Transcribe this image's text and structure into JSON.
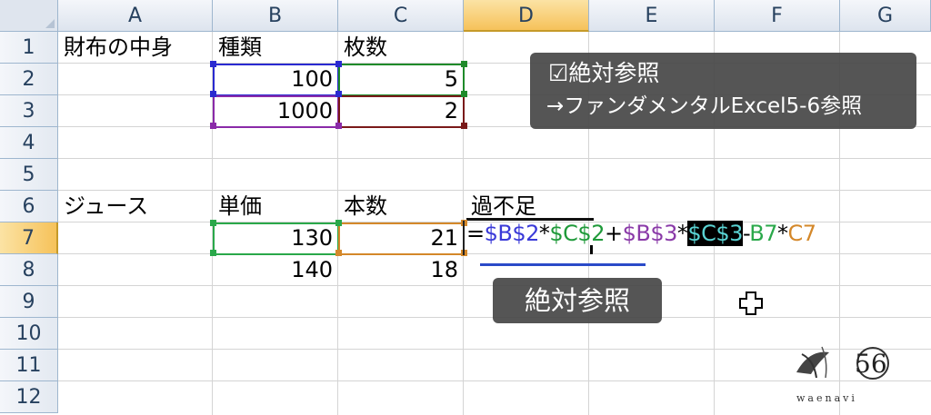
{
  "columns": [
    "A",
    "B",
    "C",
    "D",
    "E",
    "F",
    "G"
  ],
  "selected_column": "D",
  "rows": [
    "1",
    "2",
    "3",
    "4",
    "5",
    "6",
    "7",
    "8",
    "9",
    "10",
    "11",
    "12"
  ],
  "selected_row": "7",
  "cells": {
    "A1": "財布の中身",
    "B1": "種類",
    "C1": "枚数",
    "B2": "100",
    "C2": "5",
    "B3": "1000",
    "C3": "2",
    "A6": "ジュース",
    "B6": "単価",
    "C6": "本数",
    "D6": "過不足",
    "B7": "130",
    "C7": "21",
    "B8": "140",
    "C8": "18"
  },
  "formula_parts": [
    {
      "text": "=",
      "color": "#000000"
    },
    {
      "text": "$B$2",
      "color": "#3a3ad8"
    },
    {
      "text": "*",
      "color": "#000000"
    },
    {
      "text": "$C$2",
      "color": "#1f9a3a"
    },
    {
      "text": "+",
      "color": "#000000"
    },
    {
      "text": "$B$3",
      "color": "#8a3aa8"
    },
    {
      "text": "*",
      "color": "#000000"
    },
    {
      "text": "$C$3",
      "color": "#5ad4d4",
      "highlighted": true
    },
    {
      "text": "-",
      "color": "#000000"
    },
    {
      "text": "B7",
      "color": "#2aa84a"
    },
    {
      "text": "*",
      "color": "#000000"
    },
    {
      "text": "C7",
      "color": "#d4882a"
    }
  ],
  "note": {
    "line1": "☑絶対参照",
    "line2": "→ファンダメンタルExcel5-6参照"
  },
  "caption": "絶対参照",
  "logo": {
    "text": "waenavi",
    "mark": "56"
  },
  "colors": {
    "ref_b2": "#2a2ad0",
    "ref_c2": "#1f8a2a",
    "ref_b3": "#8a2aa8",
    "ref_c3": "#7a1a1a",
    "ref_b7": "#2aa84a",
    "ref_c7": "#d4882a",
    "underline": "#2a4ac8"
  }
}
